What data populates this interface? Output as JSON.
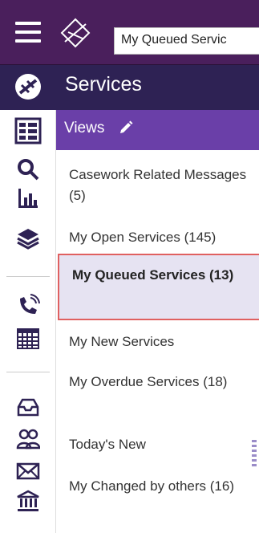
{
  "header": {
    "search_value": "My Queued Servic"
  },
  "section": {
    "title": "Services"
  },
  "views": {
    "label": "Views"
  },
  "view_items": [
    "Casework Related Messages (5)",
    "My Open Services (145)",
    "My Queued Services (13)",
    "My New Services",
    "My Overdue Services (18)",
    "Today's New",
    "My Changed by others (16)"
  ],
  "colors": {
    "topbar": "#4a1f5c",
    "section_bar": "#2e2254",
    "views_bar": "#6a3fa8",
    "selected_bg": "#e6e3f2",
    "selected_border": "#e06060"
  },
  "icons": [
    "menu-icon",
    "app-logo-icon",
    "services-icon",
    "views-grid-icon",
    "search-icon",
    "chart-icon",
    "layers-icon",
    "phone-icon",
    "calendar-icon",
    "inbox-icon",
    "people-icon",
    "mail-icon",
    "bank-icon",
    "edit-icon"
  ]
}
